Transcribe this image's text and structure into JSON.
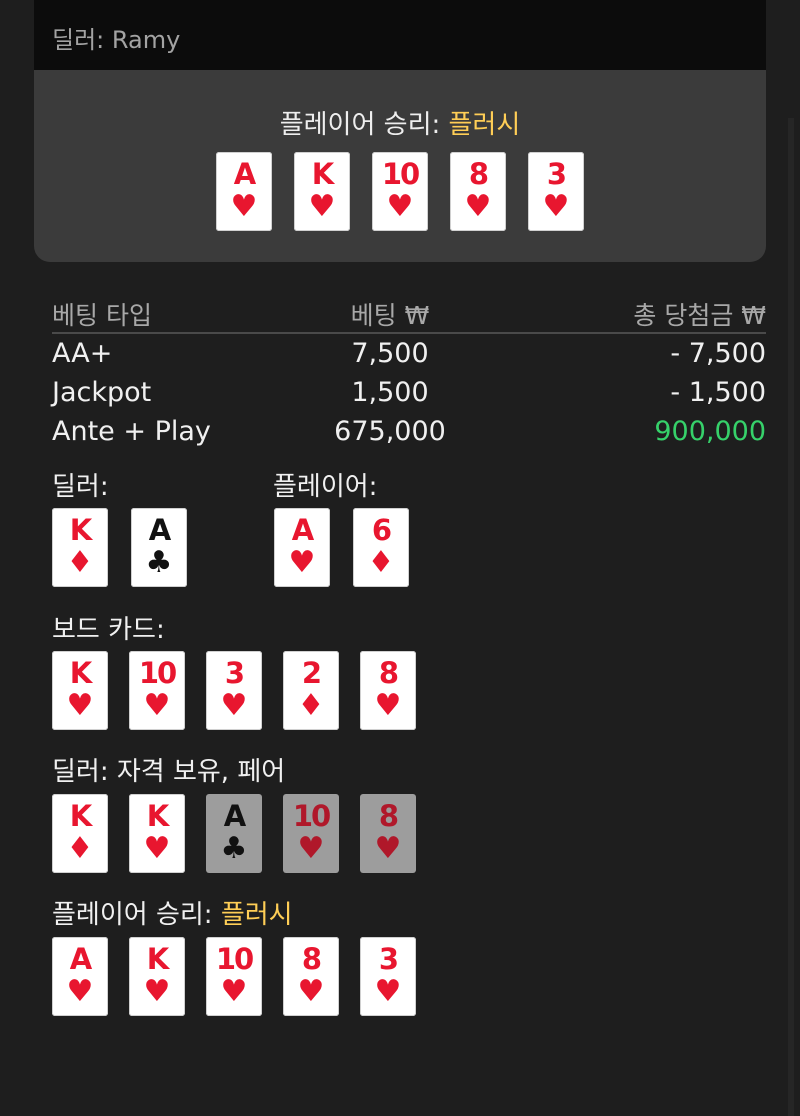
{
  "header": {
    "dealer_label": "딜러: Ramy"
  },
  "result": {
    "title_prefix": "플레이어 승리:",
    "title_hand": "플러시",
    "cards": [
      {
        "rank": "A",
        "suit": "♥",
        "color": "red"
      },
      {
        "rank": "K",
        "suit": "♥",
        "color": "red"
      },
      {
        "rank": "10",
        "suit": "♥",
        "color": "red"
      },
      {
        "rank": "8",
        "suit": "♥",
        "color": "red"
      },
      {
        "rank": "3",
        "suit": "♥",
        "color": "red"
      }
    ]
  },
  "bets": {
    "headers": {
      "type": "베팅 타입",
      "bet": "베팅 ₩",
      "payout": "총 당첨금 ₩"
    },
    "rows": [
      {
        "type": "AA+",
        "bet": "7,500",
        "payout": "- 7,500",
        "win": false
      },
      {
        "type": "Jackpot",
        "bet": "1,500",
        "payout": "- 1,500",
        "win": false
      },
      {
        "type": "Ante + Play",
        "bet": "675,000",
        "payout": "900,000",
        "win": true
      }
    ]
  },
  "hands": {
    "dealer_label": "딜러:",
    "dealer_cards": [
      {
        "rank": "K",
        "suit": "♦",
        "color": "red"
      },
      {
        "rank": "A",
        "suit": "♣",
        "color": "black"
      }
    ],
    "player_label": "플레이어:",
    "player_cards": [
      {
        "rank": "A",
        "suit": "♥",
        "color": "red"
      },
      {
        "rank": "6",
        "suit": "♦",
        "color": "red"
      }
    ]
  },
  "board": {
    "label": "보드 카드:",
    "cards": [
      {
        "rank": "K",
        "suit": "♥",
        "color": "red"
      },
      {
        "rank": "10",
        "suit": "♥",
        "color": "red"
      },
      {
        "rank": "3",
        "suit": "♥",
        "color": "red"
      },
      {
        "rank": "2",
        "suit": "♦",
        "color": "red"
      },
      {
        "rank": "8",
        "suit": "♥",
        "color": "red"
      }
    ]
  },
  "dealer_result": {
    "label": "딜러: 자격 보유, 페어",
    "cards": [
      {
        "rank": "K",
        "suit": "♦",
        "color": "red",
        "dim": false
      },
      {
        "rank": "K",
        "suit": "♥",
        "color": "red",
        "dim": false
      },
      {
        "rank": "A",
        "suit": "♣",
        "color": "black",
        "dim": true
      },
      {
        "rank": "10",
        "suit": "♥",
        "color": "red",
        "dim": true
      },
      {
        "rank": "8",
        "suit": "♥",
        "color": "red",
        "dim": true
      }
    ]
  },
  "player_result": {
    "label_prefix": "플레이어 승리:",
    "label_hand": "플러시",
    "cards": [
      {
        "rank": "A",
        "suit": "♥",
        "color": "red"
      },
      {
        "rank": "K",
        "suit": "♥",
        "color": "red"
      },
      {
        "rank": "10",
        "suit": "♥",
        "color": "red"
      },
      {
        "rank": "8",
        "suit": "♥",
        "color": "red"
      },
      {
        "rank": "3",
        "suit": "♥",
        "color": "red"
      }
    ]
  },
  "colors": {
    "highlight": "#ffce56",
    "win": "#36d16a",
    "card_red": "#e8162f"
  }
}
